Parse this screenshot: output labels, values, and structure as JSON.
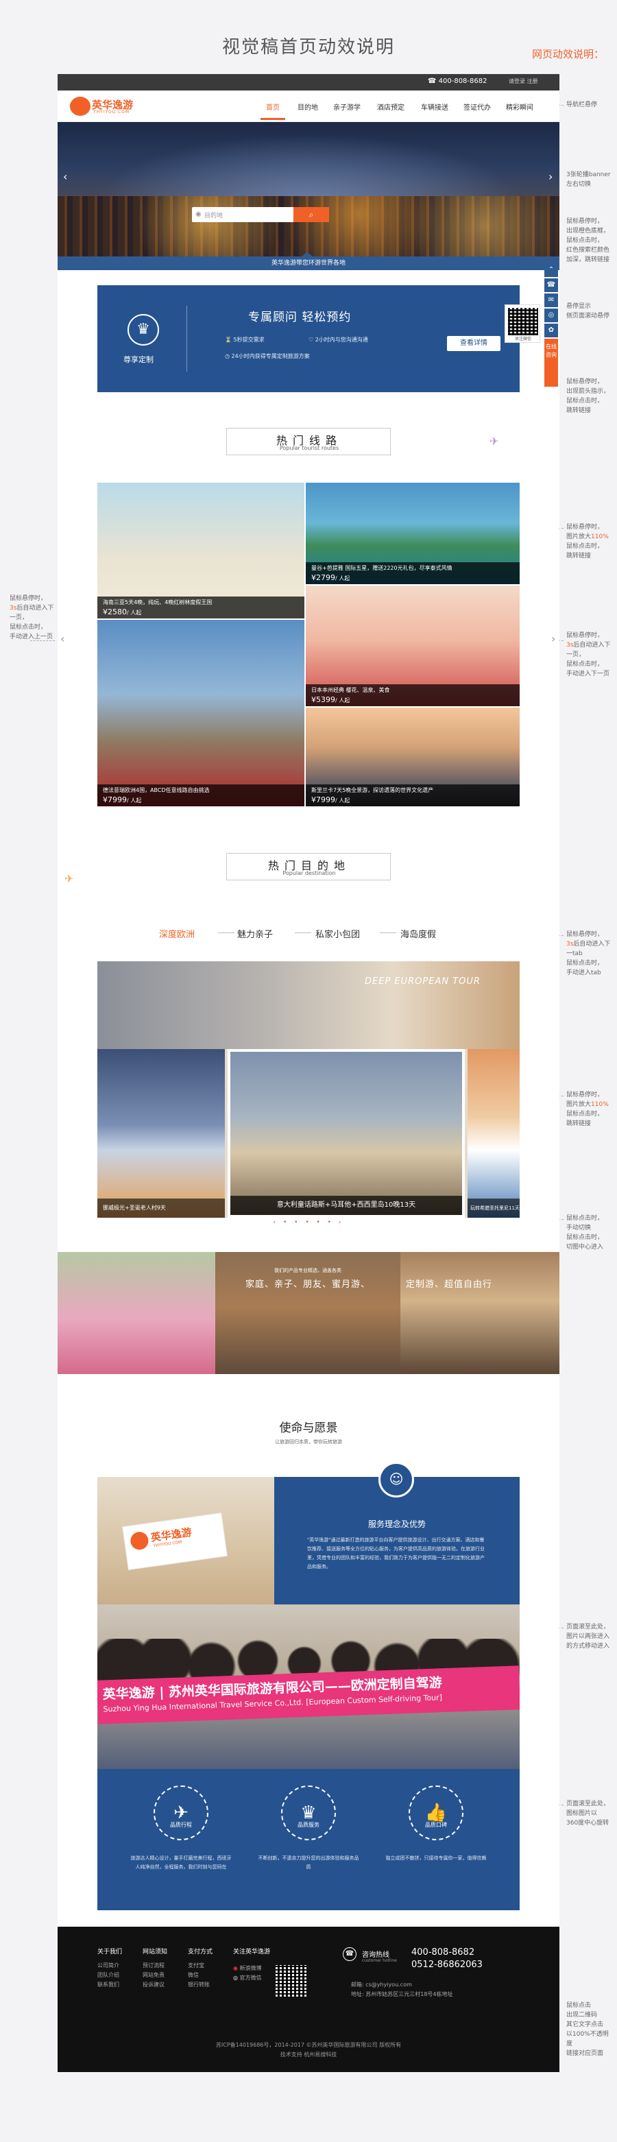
{
  "doc": {
    "title": "视觉稿首页动效说明",
    "subtitle": "网页动效说明："
  },
  "notes": {
    "nav": "导航栏悬停",
    "banner": "3张轮播banner左右切换",
    "search": [
      "鼠标悬停时，",
      "出现橙色底框，",
      "鼠标点击时，",
      "红色搜索栏颜色加深，跳转链接"
    ],
    "sidebar": [
      "悬停显示",
      "侧页面滚动悬停"
    ],
    "sidebar2": [
      "鼠标悬停时，",
      "出现箭头指示，",
      "鼠标点击时，",
      "跳转链接"
    ],
    "tiles_right": [
      "鼠标悬停时，",
      "图片放大",
      "110%",
      "鼠标点击时，",
      "跳转链接"
    ],
    "tiles_left": [
      "鼠标悬停时，",
      "3s",
      "后自动进入下一页，",
      "鼠标点击时，",
      "手动进入上一页"
    ],
    "tiles_right2": [
      "鼠标悬停时，",
      "3s",
      "后自动进入下一页，",
      "鼠标点击时，",
      "手动进入下一页"
    ],
    "dest_tabs": [
      "鼠标悬停时，",
      "3s",
      "后自动进入下一tab",
      "鼠标点击时，",
      "手动进入tab"
    ],
    "dest_hover": [
      "鼠标悬停时，",
      "图片放大",
      "110%",
      "鼠标点击时，",
      "跳转链接"
    ],
    "dest_slide": [
      "鼠标点击时，",
      "手动切换",
      "鼠标点击时，",
      "切图中心进入"
    ],
    "team": [
      "页面滚至此处，",
      "图片以两张进入",
      "的方式移动进入"
    ],
    "values": [
      "页面滚至此处，",
      "图标图片以",
      "360度中心旋转"
    ],
    "footer": [
      "鼠标点击",
      "出现二维码",
      "其它文字点击",
      "以100%不透明度",
      "链接对应页面"
    ]
  },
  "topbar": {
    "phone": "400-808-8682",
    "links": "请登录  注册"
  },
  "brand": {
    "name": "英华逸游",
    "en": "YHYIYOU.COM"
  },
  "nav": [
    "首页",
    "目的地",
    "亲子游学",
    "酒店预定",
    "车辆接送",
    "签证代办",
    "精彩瞬间"
  ],
  "banner": {
    "search_placeholder": "目的地",
    "prev": "‹",
    "next": "›",
    "strip": "英华逸游带您环游世界各地"
  },
  "consult": {
    "title": "专属顾问    轻松预约",
    "badge": "尊享定制",
    "items": [
      "5秒提交需求",
      "2小时内与您沟通沟通",
      "24小时内获得专属定制旅游方案"
    ],
    "more": "查看详情"
  },
  "sidebar": {
    "top": "⌃",
    "btns": [
      "☎",
      "✉",
      "◎",
      "✿"
    ],
    "consult": "在线咨询",
    "qr_text": "关注微信"
  },
  "routes": {
    "title": "热门线路",
    "en": "Popular tourist routes",
    "items": [
      {
        "name": "海南三亚5天4晚，纯玩、4晚红树林度假王国",
        "price": "¥2580",
        "unit": "/ 人起"
      },
      {
        "name": "曼谷+芭提雅 国际五星，赠送2220元礼包，尽享泰式风情",
        "price": "¥2799",
        "unit": "/ 人起"
      },
      {
        "name": "日本本州经典 樱花、温泉、美食",
        "price": "¥5399",
        "unit": "/ 人起"
      },
      {
        "name": "德法意瑞欧洲4国，ABCD任意线路自由挑选",
        "price": "¥7999",
        "unit": "/ 人起"
      },
      {
        "name": "斯里兰卡7天5晚全景游，探访遗落的世界文化遗产",
        "price": "¥7999",
        "unit": "/ 人起"
      }
    ],
    "prev": "‹",
    "next": "›"
  },
  "dest": {
    "title": "热门目的地",
    "en": "Popular destination",
    "tabs": [
      "深度欧洲",
      "魅力亲子",
      "私家小包团",
      "海岛度假"
    ],
    "banner_text": "DEEP EUROPEAN TOUR",
    "feature": "意大利童话路斯+马耳他+西西里岛10晚13天",
    "left_cap": "挪威极光+圣诞老人村9天",
    "right_cap": "玩转希腊圣托里尼11天",
    "dots": "‹ • • • • • ›"
  },
  "cats": {
    "title": "家庭、亲子、朋友、蜜月游、",
    "title2": "定制游、超值自由行",
    "sub": "我们的产品专业精选，涵盖各类"
  },
  "mission": {
    "title": "使命与愿景",
    "sub": "让旅游回归本质，带你玩转旅游",
    "svc_title": "服务理念及优势",
    "svc_body": "\"英华逸游\"通过最新打造的旅游平台向客户提供旅游设计、出行交通方案、酒店和餐饮推荐、接送服务等全方位的贴心服务，为客户提供高品质的旅游体验。在旅游行业里，凭借专业的团队和丰富的经验，我们致力于为客户提供独一无二的定制化旅游产品和服务。",
    "card_name": "英华逸游",
    "card_en": "YHYIYOU.COM",
    "banner1": "英华逸游 | 苏州英华国际旅游有限公司——欧洲定制自驾游",
    "banner2": "Suzhou Ying Hua International Travel Service Co.,Ltd. [European Custom Self-driving Tour]",
    "values": [
      {
        "label": "品质行程",
        "icon": "✈",
        "desc": "旅游达人精心设计，量手打磨完美行程，西班牙人纯净自然，全程服务，我们时刻与您同在"
      },
      {
        "label": "品质服务",
        "icon": "♛",
        "desc": "不断创新，不遗余力提升您的出游体验和服务品质"
      },
      {
        "label": "品质口碑",
        "icon": "👍",
        "desc": "独立成团不散拼，只接待专属你一家，值得信赖"
      }
    ]
  },
  "footer": {
    "cols": [
      {
        "h": "关于我们",
        "items": [
          "公司简介",
          "团队介绍",
          "联系我们"
        ]
      },
      {
        "h": "网站须知",
        "items": [
          "预订流程",
          "网站免责",
          "投诉建议"
        ]
      },
      {
        "h": "支付方式",
        "items": [
          "支付宝",
          "微信",
          "银行转账"
        ]
      },
      {
        "h": "关注英华逸游",
        "items": [
          "新浪微博",
          "官方微信"
        ]
      }
    ],
    "hotline_label": "咨询热线",
    "hotline_sub": "customer hotline",
    "tel1": "400-808-8682",
    "tel2": "0512-86862063",
    "email": "邮箱: cs@yhyiyou.com",
    "addr": "地址: 苏州市姑苏区三元三村18号4栋地址",
    "copy1": "苏ICP备14019686号，2014-2017 ©苏州英华国际旅游有限公司 版权所有",
    "copy2": "技术支持 杭州易搜科技"
  }
}
